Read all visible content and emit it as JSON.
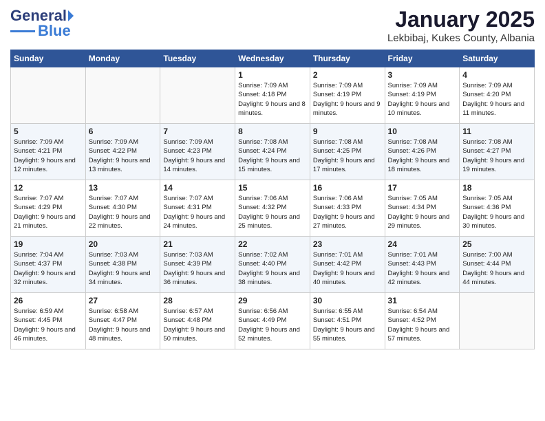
{
  "logo": {
    "general": "General",
    "blue": "Blue"
  },
  "header": {
    "title": "January 2025",
    "subtitle": "Lekbibaj, Kukes County, Albania"
  },
  "days_of_week": [
    "Sunday",
    "Monday",
    "Tuesday",
    "Wednesday",
    "Thursday",
    "Friday",
    "Saturday"
  ],
  "weeks": [
    [
      {
        "day": "",
        "sunrise": "",
        "sunset": "",
        "daylight": "",
        "empty": true
      },
      {
        "day": "",
        "sunrise": "",
        "sunset": "",
        "daylight": "",
        "empty": true
      },
      {
        "day": "",
        "sunrise": "",
        "sunset": "",
        "daylight": "",
        "empty": true
      },
      {
        "day": "1",
        "sunrise": "Sunrise: 7:09 AM",
        "sunset": "Sunset: 4:18 PM",
        "daylight": "Daylight: 9 hours and 8 minutes."
      },
      {
        "day": "2",
        "sunrise": "Sunrise: 7:09 AM",
        "sunset": "Sunset: 4:19 PM",
        "daylight": "Daylight: 9 hours and 9 minutes."
      },
      {
        "day": "3",
        "sunrise": "Sunrise: 7:09 AM",
        "sunset": "Sunset: 4:19 PM",
        "daylight": "Daylight: 9 hours and 10 minutes."
      },
      {
        "day": "4",
        "sunrise": "Sunrise: 7:09 AM",
        "sunset": "Sunset: 4:20 PM",
        "daylight": "Daylight: 9 hours and 11 minutes."
      }
    ],
    [
      {
        "day": "5",
        "sunrise": "Sunrise: 7:09 AM",
        "sunset": "Sunset: 4:21 PM",
        "daylight": "Daylight: 9 hours and 12 minutes."
      },
      {
        "day": "6",
        "sunrise": "Sunrise: 7:09 AM",
        "sunset": "Sunset: 4:22 PM",
        "daylight": "Daylight: 9 hours and 13 minutes."
      },
      {
        "day": "7",
        "sunrise": "Sunrise: 7:09 AM",
        "sunset": "Sunset: 4:23 PM",
        "daylight": "Daylight: 9 hours and 14 minutes."
      },
      {
        "day": "8",
        "sunrise": "Sunrise: 7:08 AM",
        "sunset": "Sunset: 4:24 PM",
        "daylight": "Daylight: 9 hours and 15 minutes."
      },
      {
        "day": "9",
        "sunrise": "Sunrise: 7:08 AM",
        "sunset": "Sunset: 4:25 PM",
        "daylight": "Daylight: 9 hours and 17 minutes."
      },
      {
        "day": "10",
        "sunrise": "Sunrise: 7:08 AM",
        "sunset": "Sunset: 4:26 PM",
        "daylight": "Daylight: 9 hours and 18 minutes."
      },
      {
        "day": "11",
        "sunrise": "Sunrise: 7:08 AM",
        "sunset": "Sunset: 4:27 PM",
        "daylight": "Daylight: 9 hours and 19 minutes."
      }
    ],
    [
      {
        "day": "12",
        "sunrise": "Sunrise: 7:07 AM",
        "sunset": "Sunset: 4:29 PM",
        "daylight": "Daylight: 9 hours and 21 minutes."
      },
      {
        "day": "13",
        "sunrise": "Sunrise: 7:07 AM",
        "sunset": "Sunset: 4:30 PM",
        "daylight": "Daylight: 9 hours and 22 minutes."
      },
      {
        "day": "14",
        "sunrise": "Sunrise: 7:07 AM",
        "sunset": "Sunset: 4:31 PM",
        "daylight": "Daylight: 9 hours and 24 minutes."
      },
      {
        "day": "15",
        "sunrise": "Sunrise: 7:06 AM",
        "sunset": "Sunset: 4:32 PM",
        "daylight": "Daylight: 9 hours and 25 minutes."
      },
      {
        "day": "16",
        "sunrise": "Sunrise: 7:06 AM",
        "sunset": "Sunset: 4:33 PM",
        "daylight": "Daylight: 9 hours and 27 minutes."
      },
      {
        "day": "17",
        "sunrise": "Sunrise: 7:05 AM",
        "sunset": "Sunset: 4:34 PM",
        "daylight": "Daylight: 9 hours and 29 minutes."
      },
      {
        "day": "18",
        "sunrise": "Sunrise: 7:05 AM",
        "sunset": "Sunset: 4:36 PM",
        "daylight": "Daylight: 9 hours and 30 minutes."
      }
    ],
    [
      {
        "day": "19",
        "sunrise": "Sunrise: 7:04 AM",
        "sunset": "Sunset: 4:37 PM",
        "daylight": "Daylight: 9 hours and 32 minutes."
      },
      {
        "day": "20",
        "sunrise": "Sunrise: 7:03 AM",
        "sunset": "Sunset: 4:38 PM",
        "daylight": "Daylight: 9 hours and 34 minutes."
      },
      {
        "day": "21",
        "sunrise": "Sunrise: 7:03 AM",
        "sunset": "Sunset: 4:39 PM",
        "daylight": "Daylight: 9 hours and 36 minutes."
      },
      {
        "day": "22",
        "sunrise": "Sunrise: 7:02 AM",
        "sunset": "Sunset: 4:40 PM",
        "daylight": "Daylight: 9 hours and 38 minutes."
      },
      {
        "day": "23",
        "sunrise": "Sunrise: 7:01 AM",
        "sunset": "Sunset: 4:42 PM",
        "daylight": "Daylight: 9 hours and 40 minutes."
      },
      {
        "day": "24",
        "sunrise": "Sunrise: 7:01 AM",
        "sunset": "Sunset: 4:43 PM",
        "daylight": "Daylight: 9 hours and 42 minutes."
      },
      {
        "day": "25",
        "sunrise": "Sunrise: 7:00 AM",
        "sunset": "Sunset: 4:44 PM",
        "daylight": "Daylight: 9 hours and 44 minutes."
      }
    ],
    [
      {
        "day": "26",
        "sunrise": "Sunrise: 6:59 AM",
        "sunset": "Sunset: 4:45 PM",
        "daylight": "Daylight: 9 hours and 46 minutes."
      },
      {
        "day": "27",
        "sunrise": "Sunrise: 6:58 AM",
        "sunset": "Sunset: 4:47 PM",
        "daylight": "Daylight: 9 hours and 48 minutes."
      },
      {
        "day": "28",
        "sunrise": "Sunrise: 6:57 AM",
        "sunset": "Sunset: 4:48 PM",
        "daylight": "Daylight: 9 hours and 50 minutes."
      },
      {
        "day": "29",
        "sunrise": "Sunrise: 6:56 AM",
        "sunset": "Sunset: 4:49 PM",
        "daylight": "Daylight: 9 hours and 52 minutes."
      },
      {
        "day": "30",
        "sunrise": "Sunrise: 6:55 AM",
        "sunset": "Sunset: 4:51 PM",
        "daylight": "Daylight: 9 hours and 55 minutes."
      },
      {
        "day": "31",
        "sunrise": "Sunrise: 6:54 AM",
        "sunset": "Sunset: 4:52 PM",
        "daylight": "Daylight: 9 hours and 57 minutes."
      },
      {
        "day": "",
        "sunrise": "",
        "sunset": "",
        "daylight": "",
        "empty": true
      }
    ]
  ]
}
